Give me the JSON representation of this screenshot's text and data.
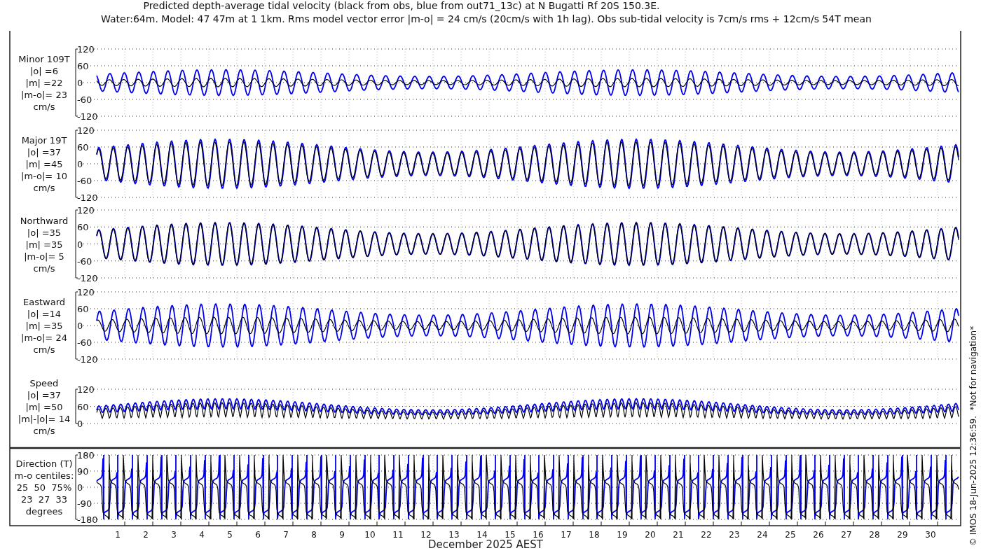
{
  "title_lines": [
    "Predicted depth-average tidal velocity (black from obs, blue from out71_13c) at N Bugatti Rf 20S 150.3E.",
    "Water:64m. Model: 47 47m at 1 1km. Rms model vector error |m-o| = 24 cm/s (20cm/s with 1h lag). Obs sub-tidal velocity is 7cm/s rms + 12cm/s 54T mean"
  ],
  "panels": [
    {
      "kind": "velocity",
      "label_lines": [
        "Minor 109T",
        "|o| =6",
        "|m| =22",
        "|m-o|= 23",
        "cm/s"
      ],
      "yticks": [
        "120",
        "60",
        "0",
        "-60",
        "-120"
      ]
    },
    {
      "kind": "velocity",
      "label_lines": [
        "Major 19T",
        "|o| =37",
        "|m| =45",
        "|m-o|= 10",
        "cm/s"
      ],
      "yticks": [
        "120",
        "60",
        "0",
        "-60",
        "-120"
      ]
    },
    {
      "kind": "velocity",
      "label_lines": [
        "Northward",
        "|o| =35",
        "|m| =35",
        "|m-o|= 5",
        "cm/s"
      ],
      "yticks": [
        "120",
        "60",
        "0",
        "-60",
        "-120"
      ]
    },
    {
      "kind": "velocity",
      "label_lines": [
        "Eastward",
        "|o| =14",
        "|m| =35",
        "|m-o|= 24",
        "cm/s"
      ],
      "yticks": [
        "120",
        "60",
        "0",
        "-60",
        "-120"
      ]
    },
    {
      "kind": "speed",
      "label_lines": [
        "Speed",
        "|o| =37",
        "|m| =50",
        "|m|-|o|= 14",
        "cm/s"
      ],
      "yticks": [
        "120",
        "60",
        "0"
      ]
    },
    {
      "kind": "direction",
      "label_lines": [
        "Direction (T)",
        "m-o centiles:",
        "25  50  75%",
        "23  27  33",
        "degrees"
      ],
      "yticks": [
        "180",
        "90",
        "0",
        "-90",
        "-180"
      ]
    }
  ],
  "x_axis": {
    "ticks": [
      "1",
      "2",
      "3",
      "4",
      "5",
      "6",
      "7",
      "8",
      "9",
      "10",
      "11",
      "12",
      "13",
      "14",
      "15",
      "16",
      "17",
      "18",
      "19",
      "20",
      "21",
      "22",
      "23",
      "24",
      "25",
      "26",
      "27",
      "28",
      "29",
      "30"
    ],
    "label": "December 2025 AEST"
  },
  "footer": "© IMOS 18-Jun-2025 12:36:59.  *Not for navigation*"
}
